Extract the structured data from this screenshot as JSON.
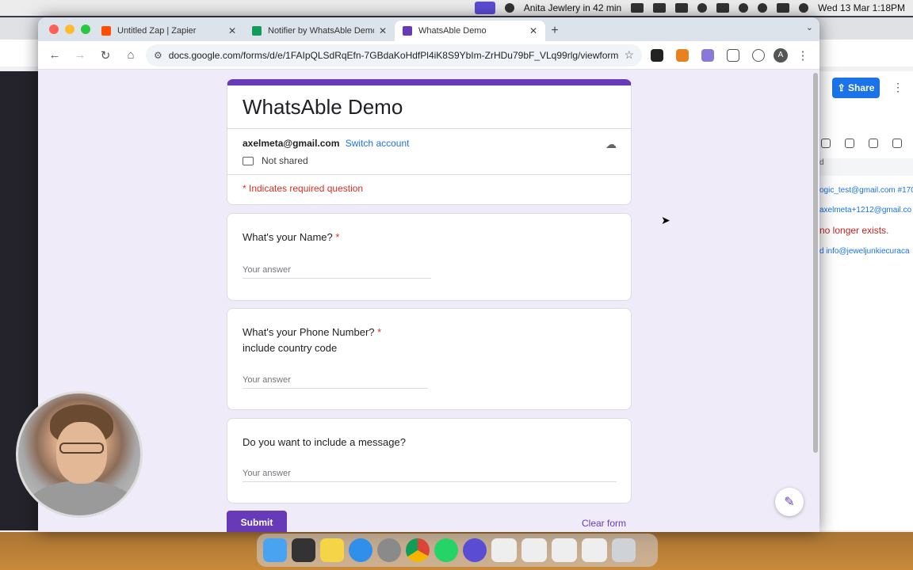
{
  "menubar": {
    "reminder": "Anita Jewlery in 42 min",
    "datetime": "Wed 13 Mar  1:18PM"
  },
  "tabs": [
    {
      "title": "Untitled Zap | Zapier",
      "favicon_color": "#ff4f00"
    },
    {
      "title": "Notifier by WhatsAble Demo",
      "favicon_color": "#0f9d58"
    },
    {
      "title": "WhatsAble Demo",
      "favicon_color": "#673ab7",
      "active": true
    }
  ],
  "toolbar": {
    "url": "docs.google.com/forms/d/e/1FAIpQLSdRqEfn-7GBdaKoHdfPl4iK8S9YbIm-ZrHDu79bF_VLq99rlg/viewform",
    "avatar_letter": "A"
  },
  "form": {
    "title": "WhatsAble Demo",
    "account_email": "axelmeta@gmail.com",
    "switch_account": "Switch account",
    "not_shared": "Not shared",
    "required_note": "* Indicates required question",
    "questions": [
      {
        "label": "What's your Name?",
        "required": "*",
        "placeholder": "Your answer"
      },
      {
        "label": "What's your Phone Number?",
        "required": "*",
        "sub": "include country code",
        "placeholder": "Your answer"
      },
      {
        "label": "Do you want to include a message?",
        "placeholder": "Your answer"
      }
    ],
    "submit": "Submit",
    "clear": "Clear form"
  },
  "bg_panel": {
    "share": "Share",
    "rows": [
      "ogic_test@gmail.com #170",
      "axelmeta+1212@gmail.co",
      "no longer exists.",
      "d  info@jeweljunkiecuraca"
    ]
  },
  "colors": {
    "form_accent": "#673ab7",
    "page_bg": "#f0ebf8",
    "required": "#d93025",
    "link": "#1a73e8"
  }
}
